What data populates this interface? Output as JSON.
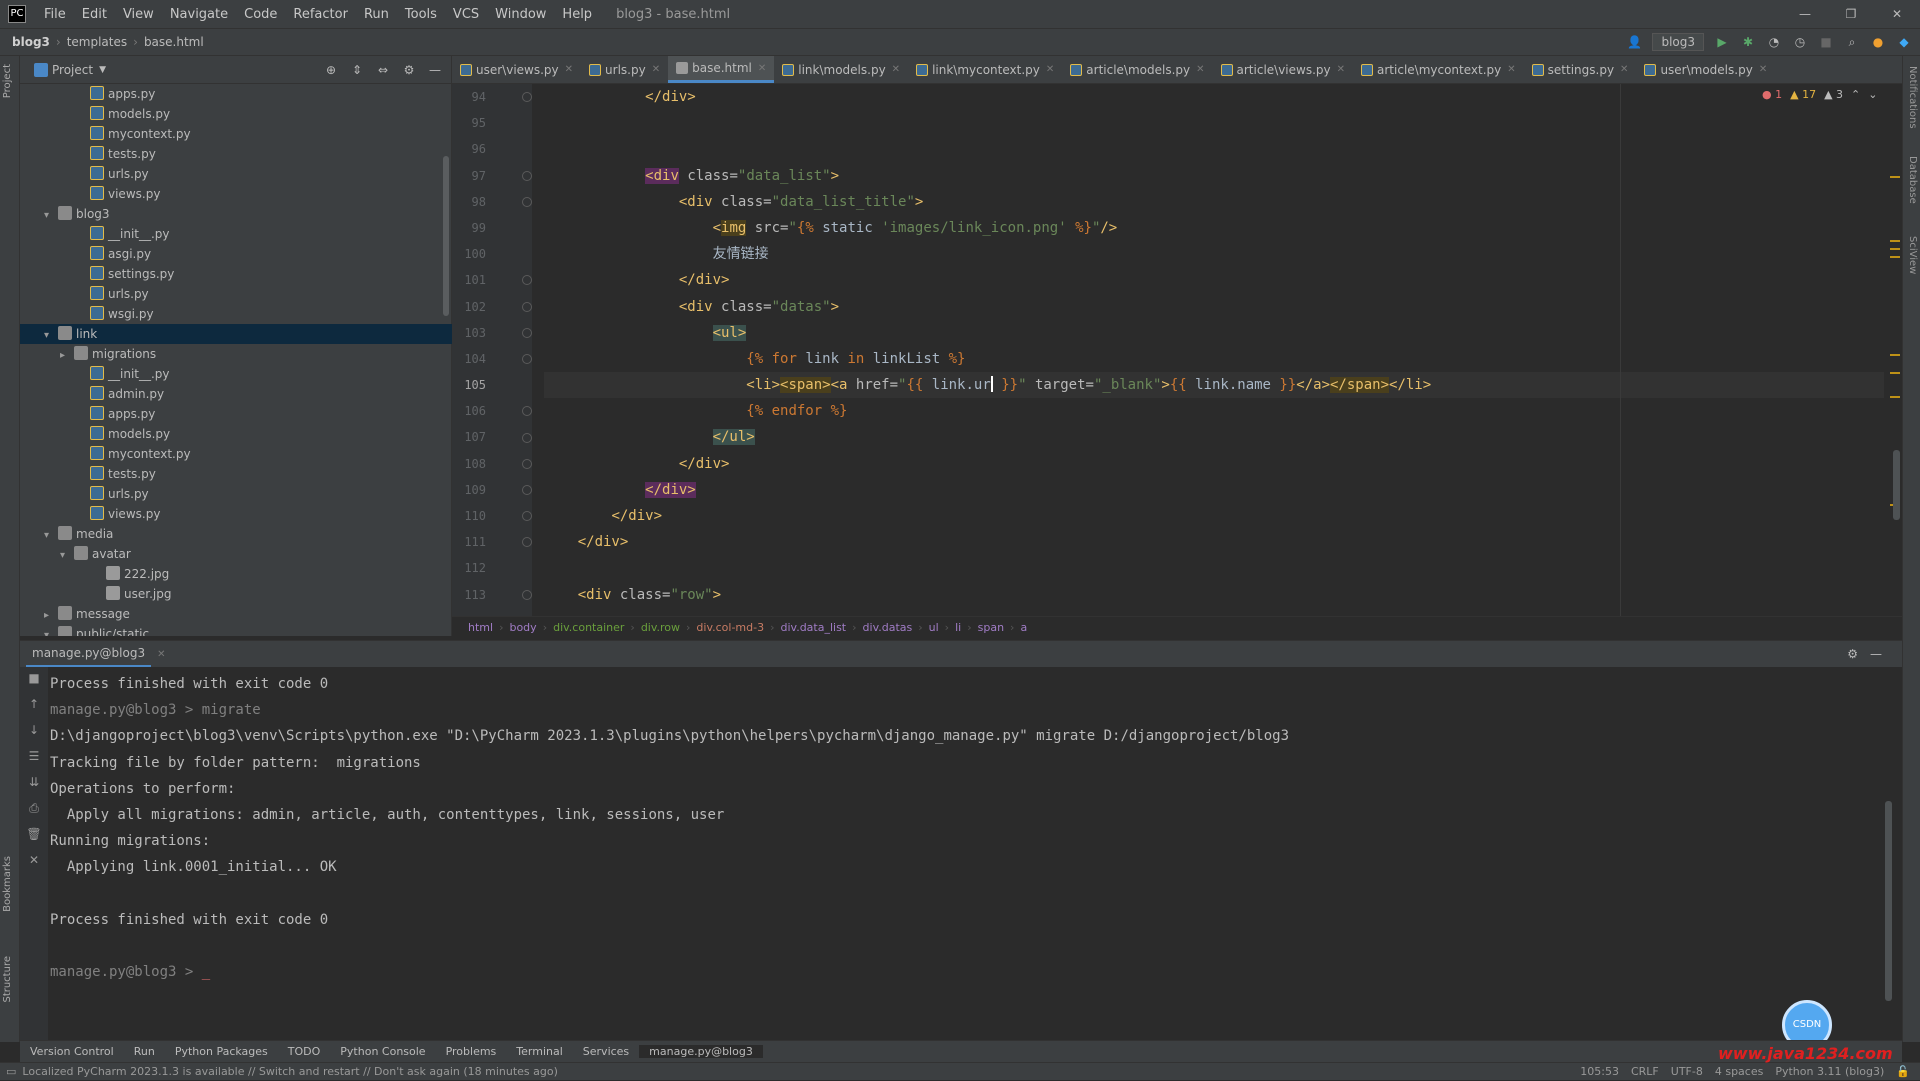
{
  "menubar": {
    "items": [
      "File",
      "Edit",
      "View",
      "Navigate",
      "Code",
      "Refactor",
      "Run",
      "Tools",
      "VCS",
      "Window",
      "Help"
    ],
    "window_title": "blog3 - base.html"
  },
  "navbar": {
    "breadcrumbs": [
      "blog3",
      "templates",
      "base.html"
    ],
    "run_config": "blog3"
  },
  "project": {
    "title": "Project",
    "tree": [
      {
        "label": "apps.py",
        "type": "py",
        "depth": 3
      },
      {
        "label": "models.py",
        "type": "py",
        "depth": 3
      },
      {
        "label": "mycontext.py",
        "type": "py",
        "depth": 3
      },
      {
        "label": "tests.py",
        "type": "py",
        "depth": 3
      },
      {
        "label": "urls.py",
        "type": "py",
        "depth": 3
      },
      {
        "label": "views.py",
        "type": "py",
        "depth": 3
      },
      {
        "label": "blog3",
        "type": "folder",
        "depth": 1,
        "arrow": "v"
      },
      {
        "label": "__init__.py",
        "type": "py",
        "depth": 3
      },
      {
        "label": "asgi.py",
        "type": "py",
        "depth": 3
      },
      {
        "label": "settings.py",
        "type": "py",
        "depth": 3
      },
      {
        "label": "urls.py",
        "type": "py",
        "depth": 3
      },
      {
        "label": "wsgi.py",
        "type": "py",
        "depth": 3
      },
      {
        "label": "link",
        "type": "folder",
        "depth": 1,
        "arrow": "v",
        "selected": true
      },
      {
        "label": "migrations",
        "type": "folder",
        "depth": 2,
        "arrow": ">"
      },
      {
        "label": "__init__.py",
        "type": "py",
        "depth": 3
      },
      {
        "label": "admin.py",
        "type": "py",
        "depth": 3
      },
      {
        "label": "apps.py",
        "type": "py",
        "depth": 3
      },
      {
        "label": "models.py",
        "type": "py",
        "depth": 3
      },
      {
        "label": "mycontext.py",
        "type": "py",
        "depth": 3
      },
      {
        "label": "tests.py",
        "type": "py",
        "depth": 3
      },
      {
        "label": "urls.py",
        "type": "py",
        "depth": 3
      },
      {
        "label": "views.py",
        "type": "py",
        "depth": 3
      },
      {
        "label": "media",
        "type": "folder",
        "depth": 1,
        "arrow": "v"
      },
      {
        "label": "avatar",
        "type": "folder",
        "depth": 2,
        "arrow": "v"
      },
      {
        "label": "222.jpg",
        "type": "file",
        "depth": 4
      },
      {
        "label": "user.jpg",
        "type": "file",
        "depth": 4
      },
      {
        "label": "message",
        "type": "folder",
        "depth": 1,
        "arrow": ">"
      },
      {
        "label": "public/static",
        "type": "folder",
        "depth": 1,
        "arrow": "v"
      }
    ]
  },
  "tabs": [
    {
      "label": "user\\views.py",
      "active": false
    },
    {
      "label": "urls.py",
      "active": false
    },
    {
      "label": "base.html",
      "active": true
    },
    {
      "label": "link\\models.py",
      "active": false
    },
    {
      "label": "link\\mycontext.py",
      "active": false
    },
    {
      "label": "article\\models.py",
      "active": false
    },
    {
      "label": "article\\views.py",
      "active": false
    },
    {
      "label": "article\\mycontext.py",
      "active": false
    },
    {
      "label": "settings.py",
      "active": false
    },
    {
      "label": "user\\models.py",
      "active": false
    }
  ],
  "inspections": {
    "errors": "1",
    "warnings": "17",
    "weak": "3"
  },
  "editor": {
    "line_numbers": [
      "94",
      "95",
      "96",
      "97",
      "98",
      "99",
      "100",
      "101",
      "102",
      "103",
      "104",
      "105",
      "106",
      "107",
      "108",
      "109",
      "110",
      "111",
      "112",
      "113"
    ],
    "current_line": "105"
  },
  "editor_breadcrumbs": [
    "html",
    "body",
    "div.container",
    "div.row",
    "div.col-md-3",
    "div.data_list",
    "div.datas",
    "ul",
    "li",
    "span",
    "a"
  ],
  "run_panel": {
    "tab_label": "manage.py@blog3",
    "lines": [
      "Process finished with exit code 0",
      "manage.py@blog3 > migrate",
      "D:\\djangoproject\\blog3\\venv\\Scripts\\python.exe \"D:\\PyCharm 2023.1.3\\plugins\\python\\helpers\\pycharm\\django_manage.py\" migrate D:/djangoproject/blog3",
      "Tracking file by folder pattern:  migrations",
      "Operations to perform:",
      "  Apply all migrations: admin, article, auth, contenttypes, link, sessions, user",
      "Running migrations:",
      "  Applying link.0001_initial... OK",
      "",
      "Process finished with exit code 0",
      "",
      "manage.py@blog3 > "
    ]
  },
  "toolwindows": [
    "Version Control",
    "Run",
    "Python Packages",
    "TODO",
    "Python Console",
    "Problems",
    "Terminal",
    "Services",
    "manage.py@blog3"
  ],
  "status": {
    "message": "Localized PyCharm 2023.1.3 is available // Switch and restart // Don't ask again (18 minutes ago)",
    "position": "105:53",
    "line_sep": "CRLF",
    "encoding": "UTF-8",
    "indent": "4 spaces",
    "interpreter": "Python 3.11 (blog3)"
  },
  "watermark": "www.java1234.com",
  "fab_label": "CSDN"
}
